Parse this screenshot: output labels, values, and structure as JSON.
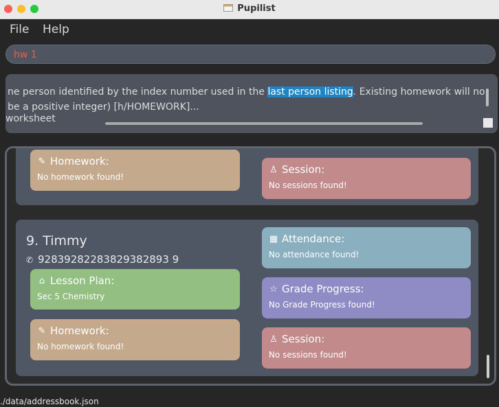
{
  "window": {
    "title": "Pupilist"
  },
  "menu": {
    "file": "File",
    "help": "Help"
  },
  "command": {
    "value": "hw 1"
  },
  "result": {
    "line1_pre": "ne person identified by the index number used in the ",
    "line1_highlight": "last person listing",
    "line1_post": ". Existing homework will no",
    "line2": ": be a positive integer) [h/HOMEWORK]...",
    "line3": "worksheet"
  },
  "cards": {
    "top": {
      "homework": {
        "title": "Homework:",
        "body": "No homework found!"
      },
      "session": {
        "title": "Session:",
        "body": "No sessions found!"
      }
    },
    "timmy": {
      "name": "9.  Timmy",
      "phone": "92839282283829382893 9",
      "attendance": {
        "title": "Attendance:",
        "body": "No attendance found!"
      },
      "lesson_plan": {
        "title": "Lesson Plan:",
        "body": "Sec 5 Chemistry"
      },
      "grade_progress": {
        "title": "Grade Progress:",
        "body": "No Grade Progress found!"
      },
      "homework": {
        "title": "Homework:",
        "body": "No homework found!"
      },
      "session": {
        "title": "Session:",
        "body": "No sessions found!"
      }
    }
  },
  "status": {
    "path": "./data/addressbook.json"
  },
  "icons": {
    "homework": "pencil-icon",
    "session": "person-icon",
    "attendance": "calendar-icon",
    "lesson_plan": "graduation-cap-icon",
    "grade_progress": "star-icon",
    "phone": "phone-icon"
  }
}
